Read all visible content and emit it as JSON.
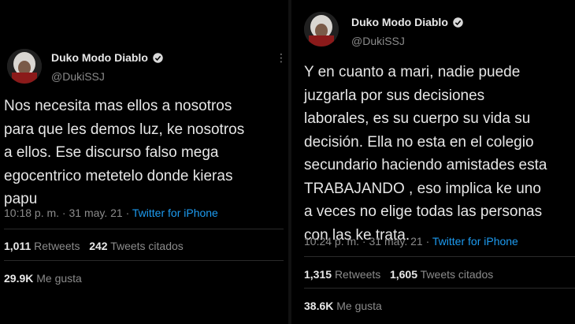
{
  "tweet_left": {
    "name": "Duko Modo Diablo",
    "handle": "@DukiSSJ",
    "text_lines": [
      "Nos necesita mas ellos a nosotros",
      "para que les demos luz, ke nosotros",
      "a ellos. Ese discurso falso mega",
      "egocentrico metetelo donde kieras",
      "papu"
    ],
    "time": "10:18 p. m. · 31 may. 21 · ",
    "source": "Twitter for iPhone",
    "retweets": "1,011",
    "retweets_label": "Retweets",
    "quotes": "242",
    "quotes_label": "Tweets citados",
    "likes": "29.9K",
    "likes_label": "Me gusta"
  },
  "tweet_right": {
    "name": "Duko Modo Diablo",
    "handle": "@DukiSSJ",
    "text_lines": [
      "Y en cuanto a mari, nadie puede",
      "juzgarla por sus decisiones",
      "laborales, es su cuerpo su vida su",
      "decisión. Ella no esta en el colegio",
      "secundario haciendo amistades esta",
      "TRABAJANDO , eso implica ke uno",
      "a veces no elige todas las personas",
      "con las ke trata."
    ],
    "time": "10:24 p. m. · 31 may. 21 · ",
    "source": "Twitter for iPhone",
    "retweets": "1,315",
    "retweets_label": "Retweets",
    "quotes": "1,605",
    "quotes_label": "Tweets citados",
    "likes": "38.6K",
    "likes_label": "Me gusta"
  },
  "colors": {
    "link": "#1d9bf0",
    "verified": "#d9d9d9",
    "muted": "#8b8b8b"
  },
  "icons": [
    "verified-badge-icon",
    "more-options-icon",
    "avatar"
  ]
}
